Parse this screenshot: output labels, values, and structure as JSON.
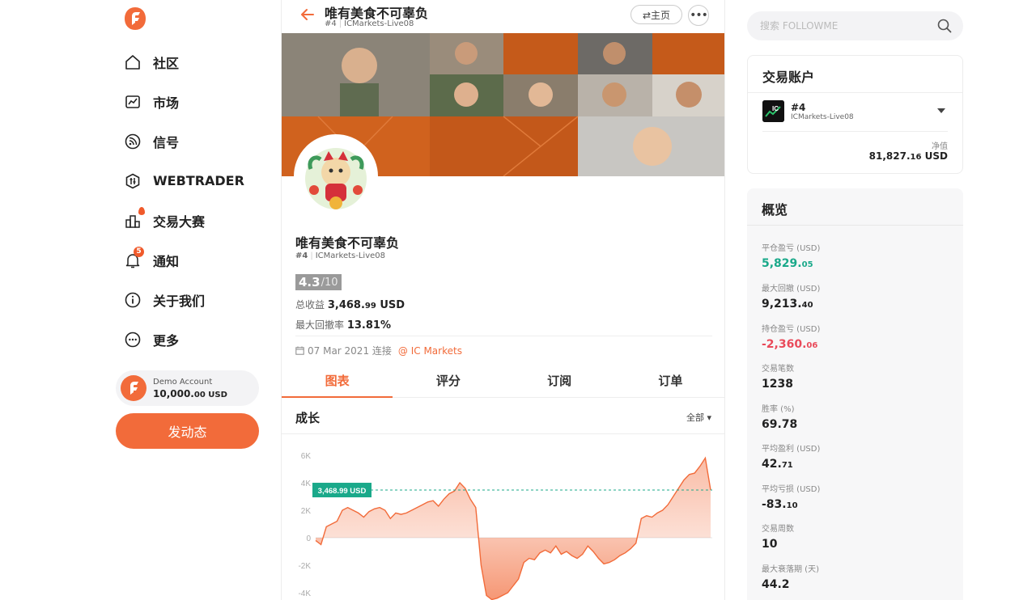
{
  "sidebar": {
    "items": [
      {
        "label": "社区",
        "icon": "home-icon"
      },
      {
        "label": "市场",
        "icon": "market-chart-icon"
      },
      {
        "label": "信号",
        "icon": "signal-icon"
      },
      {
        "label": "WEBTRADER",
        "icon": "webtrader-icon"
      },
      {
        "label": "交易大赛",
        "icon": "contest-icon"
      },
      {
        "label": "通知",
        "icon": "bell-icon",
        "badge": "5"
      },
      {
        "label": "关于我们",
        "icon": "info-icon"
      },
      {
        "label": "更多",
        "icon": "more-icon"
      }
    ],
    "demo": {
      "title": "Demo Account",
      "amount_main": "10,000.",
      "amount_dec": "00",
      "currency": " USD"
    },
    "post_button": "发动态"
  },
  "profile": {
    "name": "唯有美食不可辜负",
    "rank": "#4",
    "server": "ICMarkets-Live08",
    "home_button": "⇄主页",
    "score": "4.3",
    "score_max": "/10",
    "total_profit_label": "总收益",
    "total_profit_main": "3,468.",
    "total_profit_dec": "99",
    "total_profit_ccy": " USD",
    "max_dd_label": "最大回撤率",
    "max_dd_value": "13.81%",
    "since": "07 Mar 2021 连接",
    "broker": "@ IC Markets"
  },
  "tabs": [
    "图表",
    "评分",
    "订阅",
    "订单"
  ],
  "growth": {
    "title": "成长",
    "range": "全部 ▾"
  },
  "chart_data": {
    "type": "area",
    "yticks": [
      "6K",
      "4K",
      "2K",
      "0",
      "-2K",
      "-4K"
    ],
    "ylim": [
      -4000,
      6000
    ],
    "current_label": "3,468.99 USD",
    "current_value": 3468.99,
    "values": [
      -200,
      -500,
      800,
      1000,
      1200,
      2000,
      2200,
      2000,
      1800,
      1500,
      1900,
      2100,
      2200,
      2000,
      1400,
      1800,
      1700,
      1800,
      2000,
      2200,
      2400,
      2600,
      2700,
      2300,
      2800,
      3200,
      3400,
      4000,
      3600,
      2800,
      2200,
      -2000,
      -4200,
      -4500,
      -4400,
      -4200,
      -4000,
      -3500,
      -3000,
      -1800,
      -1500,
      -1600,
      -1100,
      -900,
      -1100,
      -600,
      -1200,
      -1000,
      -1300,
      -1500,
      -1200,
      -600,
      -1000,
      -1500,
      -1900,
      -1800,
      -1600,
      -1300,
      -1100,
      -800,
      -400,
      1400,
      1600,
      1500,
      1800,
      2000,
      2400,
      3000,
      3600,
      4200,
      4600,
      4700,
      5200,
      5800,
      3469
    ],
    "colors": {
      "line": "#f26b3a",
      "label_bg": "#1aa98a"
    }
  },
  "search": {
    "placeholder": "搜索 FOLLOWME"
  },
  "account_card": {
    "title": "交易账户",
    "number": "#4",
    "server": "ICMarkets-Live08",
    "net_label": "净值",
    "net_main": "81,827.",
    "net_dec": "16",
    "net_ccy": " USD"
  },
  "overview": {
    "title": "概览",
    "metrics": [
      {
        "label": "平仓盈亏 (USD)",
        "main": "5,829.",
        "dec": "05",
        "tone": "green"
      },
      {
        "label": "最大回撤 (USD)",
        "main": "9,213.",
        "dec": "40",
        "tone": "none"
      },
      {
        "label": "持仓盈亏 (USD)",
        "main": "-2,360.",
        "dec": "06",
        "tone": "red"
      },
      {
        "label": "交易笔数",
        "main": "1238",
        "dec": "",
        "tone": "none"
      },
      {
        "label": "胜率 (%)",
        "main": "69.78",
        "dec": "",
        "tone": "none"
      },
      {
        "label": "平均盈利 (USD)",
        "main": "42.",
        "dec": "71",
        "tone": "none"
      },
      {
        "label": "平均亏损 (USD)",
        "main": "-83.",
        "dec": "10",
        "tone": "none"
      },
      {
        "label": "交易周数",
        "main": "10",
        "dec": "",
        "tone": "none"
      },
      {
        "label": "最大衰落期 (天)",
        "main": "44.2",
        "dec": "",
        "tone": "none"
      }
    ]
  },
  "colors": {
    "accent": "#f26b3a",
    "profit": "#1aa98a",
    "loss": "#e94a5a"
  }
}
